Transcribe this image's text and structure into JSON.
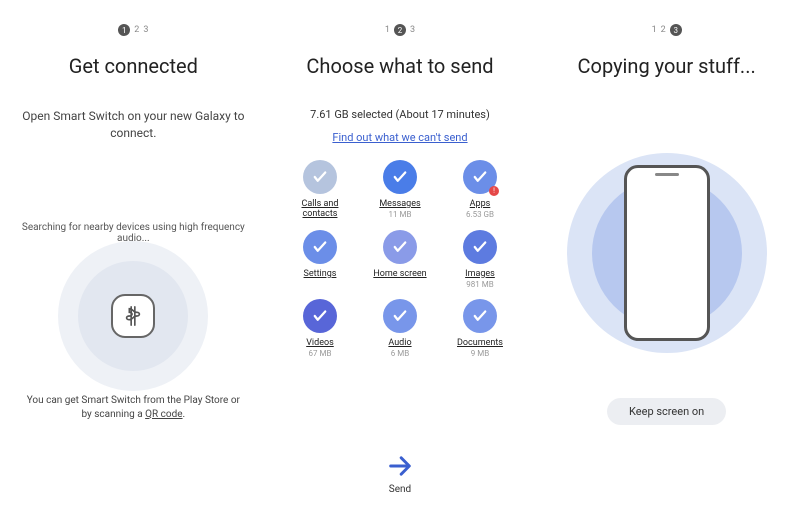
{
  "panel1": {
    "steps": [
      "1",
      "2",
      "3"
    ],
    "current_step": 0,
    "title": "Get connected",
    "subtitle": "Open Smart Switch on your new Galaxy to connect.",
    "searching": "Searching for nearby devices using high frequency audio...",
    "footer_pre": "You can get Smart Switch from the Play Store or by scanning a ",
    "footer_link": "QR code",
    "footer_post": "."
  },
  "panel2": {
    "steps": [
      "1",
      "2",
      "3"
    ],
    "current_step": 1,
    "title": "Choose what to send",
    "summary": "7.61 GB  selected (About 17 minutes)",
    "find_link": "Find out what we can't send",
    "items": [
      {
        "label": "Calls and contacts",
        "size": "",
        "color": "#b5c4de",
        "alert": false
      },
      {
        "label": "Messages",
        "size": "11 MB",
        "color": "#4a7de8",
        "alert": false
      },
      {
        "label": "Apps",
        "size": "6.53 GB",
        "color": "#6b8ee8",
        "alert": true
      },
      {
        "label": "Settings",
        "size": "",
        "color": "#6b8ee8",
        "alert": false
      },
      {
        "label": "Home screen",
        "size": "",
        "color": "#8a9be8",
        "alert": false
      },
      {
        "label": "Images",
        "size": "981 MB",
        "color": "#5d7be0",
        "alert": false
      },
      {
        "label": "Videos",
        "size": "67 MB",
        "color": "#5866d8",
        "alert": false
      },
      {
        "label": "Audio",
        "size": "6 MB",
        "color": "#7896ea",
        "alert": false
      },
      {
        "label": "Documents",
        "size": "9 MB",
        "color": "#7896ea",
        "alert": false
      }
    ],
    "send_label": "Send"
  },
  "panel3": {
    "steps": [
      "1",
      "2",
      "3"
    ],
    "current_step": 2,
    "title": "Copying your stuff...",
    "keep_screen": "Keep screen on"
  }
}
